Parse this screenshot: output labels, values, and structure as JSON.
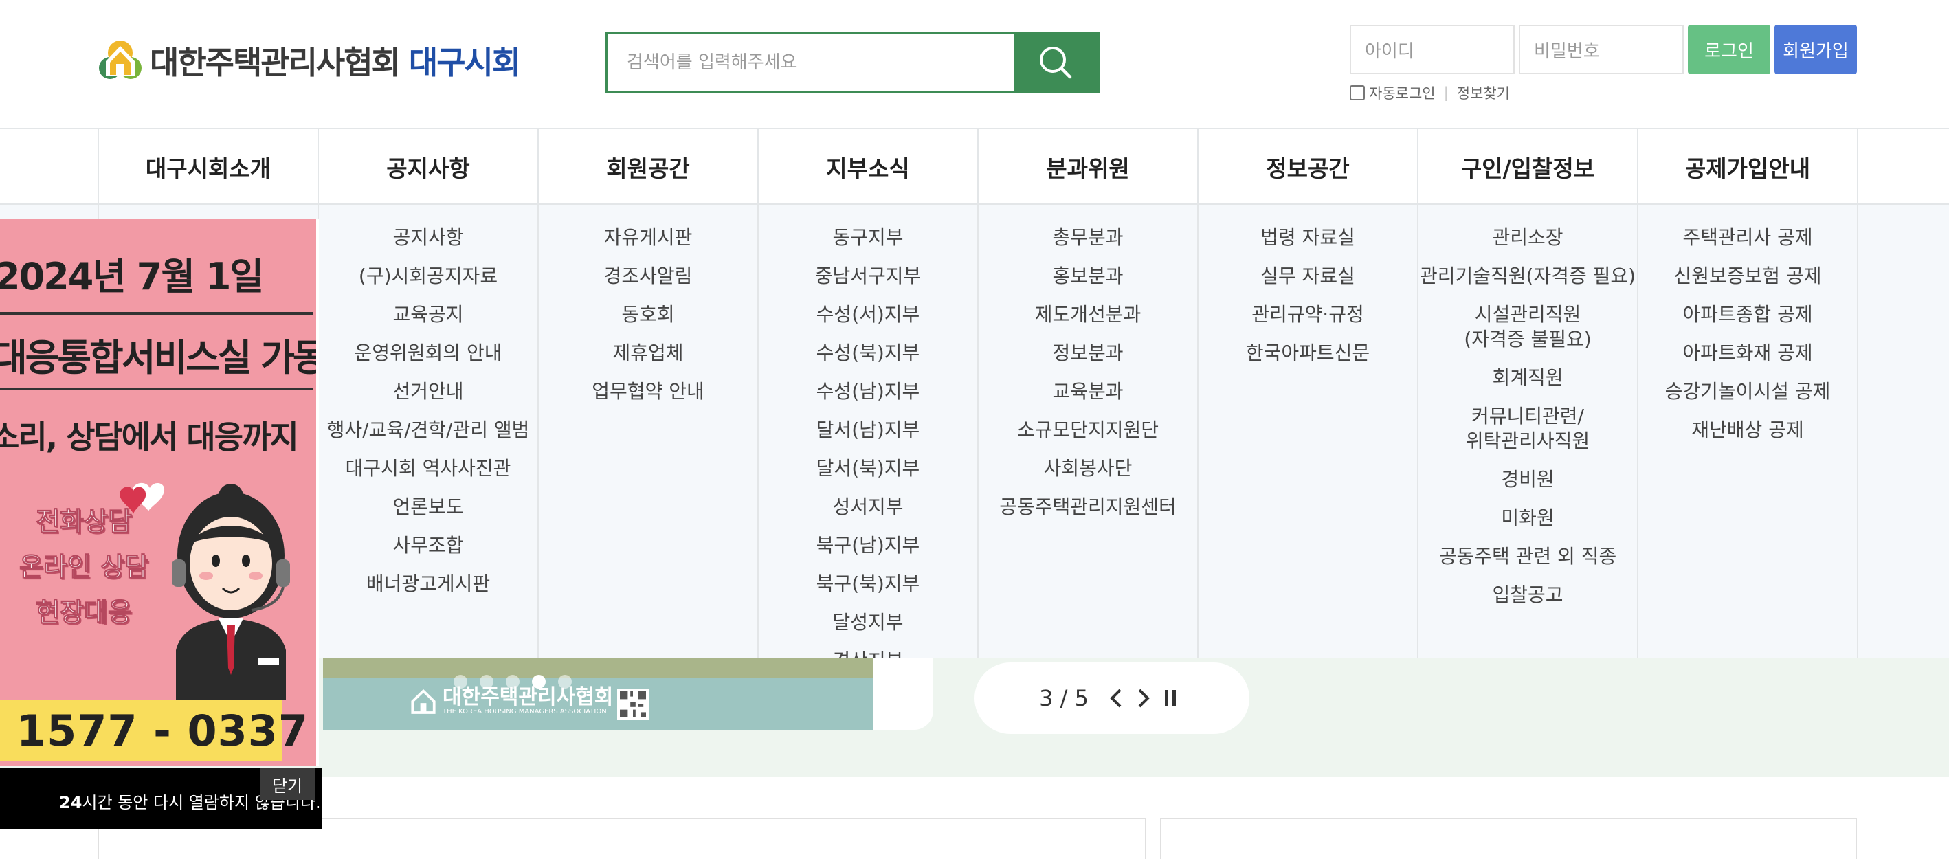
{
  "header": {
    "logo_main": "대한주택관리사협회",
    "logo_accent": "대구시회",
    "search_placeholder": "검색어를 입력해주세요",
    "login": {
      "id_placeholder": "아이디",
      "pw_placeholder": "비밀번호",
      "login_label": "로그인",
      "join_label": "회원가입",
      "auto_login": "자동로그인",
      "find_info": "정보찾기"
    }
  },
  "nav": [
    {
      "label": "대구시회소개",
      "links": []
    },
    {
      "label": "공지사항",
      "links": [
        "공지사항",
        "(구)시회공지자료",
        "교육공지",
        "운영위원회의 안내",
        "선거안내",
        "행사/교육/견학/관리 앨범",
        "대구시회 역사사진관",
        "언론보도",
        "사무조합",
        "배너광고게시판"
      ]
    },
    {
      "label": "회원공간",
      "links": [
        "자유게시판",
        "경조사알림",
        "동호회",
        "제휴업체",
        "업무협약 안내"
      ]
    },
    {
      "label": "지부소식",
      "links": [
        "동구지부",
        "중남서구지부",
        "수성(서)지부",
        "수성(북)지부",
        "수성(남)지부",
        "달서(남)지부",
        "달서(북)지부",
        "성서지부",
        "북구(남)지부",
        "북구(북)지부",
        "달성지부",
        "경산지부"
      ]
    },
    {
      "label": "분과위원",
      "links": [
        "총무분과",
        "홍보분과",
        "제도개선분과",
        "정보분과",
        "교육분과",
        "소규모단지지원단",
        "사회봉사단",
        "공동주택관리지원센터"
      ]
    },
    {
      "label": "정보공간",
      "links": [
        "법령 자료실",
        "실무 자료실",
        "관리규약·규정",
        "한국아파트신문"
      ]
    },
    {
      "label": "구인/입찰정보",
      "links": [
        "관리소장",
        "관리기술직원(자격증 필요)",
        "시설관리직원\n(자격증 불필요)",
        "회계직원",
        "커뮤니티관련/\n위탁관리사직원",
        "경비원",
        "미화원",
        "공동주택 관련 외 직종",
        "입찰공고"
      ]
    },
    {
      "label": "공제가입안내",
      "links": [
        "주택관리사 공제",
        "신원보증보험 공제",
        "아파트종합 공제",
        "아파트화재 공제",
        "승강기놀이시설 공제",
        "재난배상 공제"
      ]
    }
  ],
  "slider": {
    "counter": "3 / 5",
    "photo_logo": "대한주택관리사협회",
    "photo_logo_en": "THE KOREA HOUSING MANAGERS ASSOCIATION"
  },
  "popup": {
    "date": "2024년 7월 1일",
    "title": "대응통합서비스실 가동",
    "subtitle": "소리, 상담에서 대응까지",
    "services": [
      "전화상담",
      "온라인 상담",
      "현장대응"
    ],
    "phone": "1577 - 0337",
    "hide_hours": "24",
    "hide_msg": "시간 동안 다시 열람하지 않습니다.",
    "close_label": "닫기"
  },
  "colors": {
    "brand_green": "#3d8c55",
    "login_green": "#66c184",
    "join_blue": "#4e79d8",
    "accent_blue": "#1f4ea6",
    "popup_pink": "#f29aa5",
    "phone_yellow": "#f9dd5c"
  },
  "icons": [
    "logo-house-icon",
    "search-icon",
    "chevron-left-icon",
    "chevron-right-icon",
    "pause-icon",
    "heart-icon",
    "qr-code-icon"
  ]
}
